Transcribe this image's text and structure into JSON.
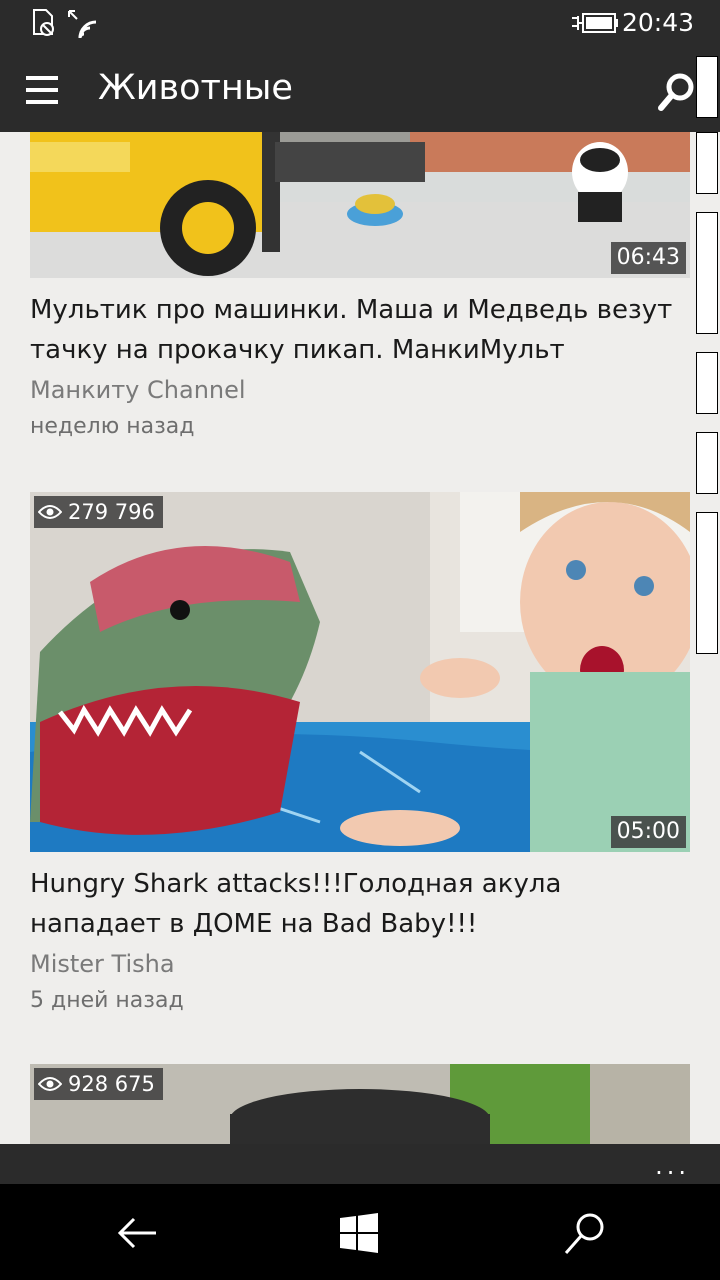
{
  "status": {
    "time": "20:43",
    "icons": [
      "notification-icon",
      "wifi-icon",
      "battery-icon"
    ]
  },
  "header": {
    "title": "Животные",
    "menu_icon": "hamburger-icon",
    "search_icon": "search-icon"
  },
  "videos": [
    {
      "title": "Мультик про машинки. Маша и Медведь везут тачку на прокачку пикап.  МанкиМульт",
      "channel": "Манкиту Channel",
      "time": "неделю назад",
      "duration": "06:43"
    },
    {
      "views": "279 796",
      "title": "Hungry Shark attacks!!!Голодная акула нападает в ДОМЕ на Bad Baby!!!",
      "channel": "Mister Tisha",
      "time": "5 дней назад",
      "duration": "05:00"
    },
    {
      "views": "928 675"
    }
  ],
  "appbar": {
    "more": "..."
  },
  "navbar": {
    "icons": [
      "back-icon",
      "windows-icon",
      "search-icon"
    ]
  },
  "colors": {
    "bar": "#2b2b2b",
    "background": "#efeeec",
    "nav": "#000000"
  }
}
